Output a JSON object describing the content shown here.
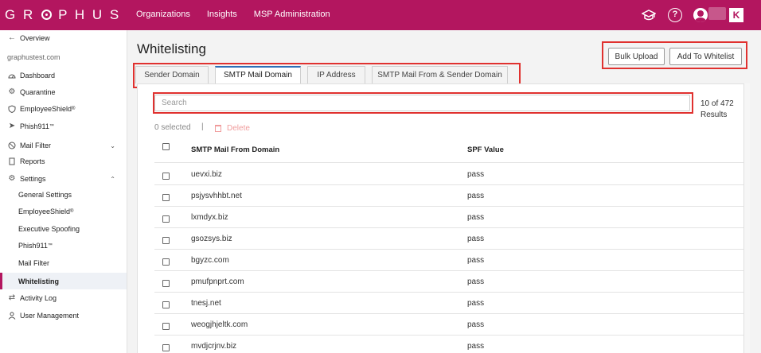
{
  "brand": {
    "logo_text": "GRAPHUS",
    "primary_color": "#b3165f"
  },
  "topnav": {
    "items": [
      "Organizations",
      "Insights",
      "MSP Administration"
    ]
  },
  "topbar_icons": [
    "graduation-cap-icon",
    "help-icon",
    "user-icon"
  ],
  "topbar_badge": "K",
  "sidebar": {
    "overview": "Overview",
    "org": "graphustest.com",
    "items": [
      {
        "label": "Dashboard"
      },
      {
        "label": "Quarantine"
      },
      {
        "label": "EmployeeShield",
        "sup": "®"
      },
      {
        "label": "Phish911",
        "sup": "™"
      },
      {
        "label": "Mail Filter"
      },
      {
        "label": "Reports"
      },
      {
        "label": "Settings"
      }
    ],
    "settings_sub": [
      {
        "label": "General Settings"
      },
      {
        "label": "EmployeeShield",
        "sup": "®"
      },
      {
        "label": "Executive Spoofing"
      },
      {
        "label": "Phish911",
        "sup": "™"
      },
      {
        "label": "Mail Filter"
      },
      {
        "label": "Whitelisting"
      }
    ],
    "bottom": [
      {
        "label": "Activity Log"
      },
      {
        "label": "User Management"
      }
    ]
  },
  "page": {
    "title": "Whitelisting",
    "bulk_upload": "Bulk Upload",
    "add_to_whitelist": "Add To Whitelist"
  },
  "tabs": [
    "Sender Domain",
    "SMTP Mail Domain",
    "IP Address",
    "SMTP Mail From & Sender Domain"
  ],
  "active_tab": "SMTP Mail Domain",
  "search": {
    "placeholder": "Search",
    "value": ""
  },
  "count": {
    "shown": "10 of 472",
    "label": "Results"
  },
  "selection": {
    "selected": "0 selected",
    "separator": "|",
    "delete": "Delete"
  },
  "table": {
    "columns": [
      "SMTP Mail From Domain",
      "SPF Value"
    ],
    "rows": [
      {
        "domain": "uevxi.biz",
        "spf": "pass"
      },
      {
        "domain": "psjysvhhbt.net",
        "spf": "pass"
      },
      {
        "domain": "lxmdyx.biz",
        "spf": "pass"
      },
      {
        "domain": "gsozsys.biz",
        "spf": "pass"
      },
      {
        "domain": "bgyzc.com",
        "spf": "pass"
      },
      {
        "domain": "pmufpnprt.com",
        "spf": "pass"
      },
      {
        "domain": "tnesj.net",
        "spf": "pass"
      },
      {
        "domain": "weogjhjeltk.com",
        "spf": "pass"
      },
      {
        "domain": "mvdjcrjnv.biz",
        "spf": "pass"
      }
    ]
  }
}
